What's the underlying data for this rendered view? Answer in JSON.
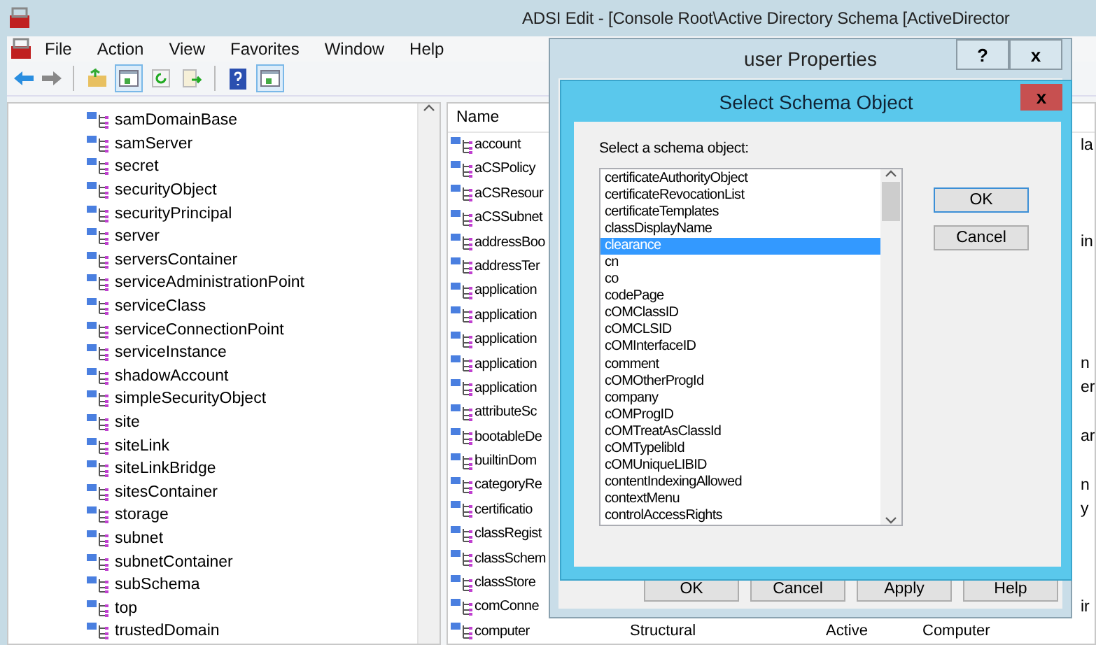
{
  "main_window": {
    "title": "ADSI Edit - [Console Root\\Active Directory Schema [ActiveDirector"
  },
  "menu": [
    "File",
    "Action",
    "View",
    "Favorites",
    "Window",
    "Help"
  ],
  "tree": {
    "items": [
      "samDomainBase",
      "samServer",
      "secret",
      "securityObject",
      "securityPrincipal",
      "server",
      "serversContainer",
      "serviceAdministrationPoint",
      "serviceClass",
      "serviceConnectionPoint",
      "serviceInstance",
      "shadowAccount",
      "simpleSecurityObject",
      "site",
      "siteLink",
      "siteLinkBridge",
      "sitesContainer",
      "storage",
      "subnet",
      "subnetContainer",
      "subSchema",
      "top",
      "trustedDomain"
    ]
  },
  "list": {
    "columns": [
      "Name"
    ],
    "rows": [
      {
        "name": "account",
        "column_5": "la"
      },
      {
        "name": "aCSPolicy"
      },
      {
        "name": "aCSResour"
      },
      {
        "name": "aCSSubnet"
      },
      {
        "name": "addressBoo",
        "column_5": "in"
      },
      {
        "name": "addressTer"
      },
      {
        "name": "application"
      },
      {
        "name": "application"
      },
      {
        "name": "application"
      },
      {
        "name": "application",
        "column_5": "n"
      },
      {
        "name": "application",
        "column_5": "er"
      },
      {
        "name": "attributeSc"
      },
      {
        "name": "bootableDe",
        "column_5": "ar"
      },
      {
        "name": "builtinDom"
      },
      {
        "name": "categoryRe",
        "column_5": "n"
      },
      {
        "name": "certificatio",
        "column_5": "y"
      },
      {
        "name": "classRegist"
      },
      {
        "name": "classSchem"
      },
      {
        "name": "classStore"
      },
      {
        "name": "comConne",
        "column_5": "ir"
      },
      {
        "name": "computer",
        "column_2": "Structural",
        "column_3": "Active",
        "column_4": "Computer"
      }
    ]
  },
  "properties_dialog": {
    "title": "user Properties",
    "title_buttons": [
      "?",
      "x"
    ],
    "buttons": [
      {
        "label": "OK"
      },
      {
        "label": "Cancel"
      },
      {
        "label": "Apply"
      },
      {
        "label": "Help"
      }
    ]
  },
  "select_dialog": {
    "title": "Select Schema Object",
    "close": "x",
    "label": "Select a schema object:",
    "items": [
      {
        "text": "certificateAuthorityObject",
        "selected": false
      },
      {
        "text": "certificateRevocationList",
        "selected": false
      },
      {
        "text": "certificateTemplates",
        "selected": false
      },
      {
        "text": "classDisplayName",
        "selected": false
      },
      {
        "text": "clearance",
        "selected": true
      },
      {
        "text": "cn",
        "selected": false
      },
      {
        "text": "co",
        "selected": false
      },
      {
        "text": "codePage",
        "selected": false
      },
      {
        "text": "cOMClassID",
        "selected": false
      },
      {
        "text": "cOMCLSID",
        "selected": false
      },
      {
        "text": "cOMInterfaceID",
        "selected": false
      },
      {
        "text": "comment",
        "selected": false
      },
      {
        "text": "cOMOtherProgId",
        "selected": false
      },
      {
        "text": "company",
        "selected": false
      },
      {
        "text": "cOMProgID",
        "selected": false
      },
      {
        "text": "cOMTreatAsClassId",
        "selected": false
      },
      {
        "text": "cOMTypelibId",
        "selected": false
      },
      {
        "text": "cOMUniqueLIBID",
        "selected": false
      },
      {
        "text": "contentIndexingAllowed",
        "selected": false
      },
      {
        "text": "contextMenu",
        "selected": false
      },
      {
        "text": "controlAccessRights",
        "selected": false
      }
    ],
    "buttons": [
      {
        "label": "OK",
        "default": true
      },
      {
        "label": "Cancel",
        "default": false
      }
    ]
  }
}
